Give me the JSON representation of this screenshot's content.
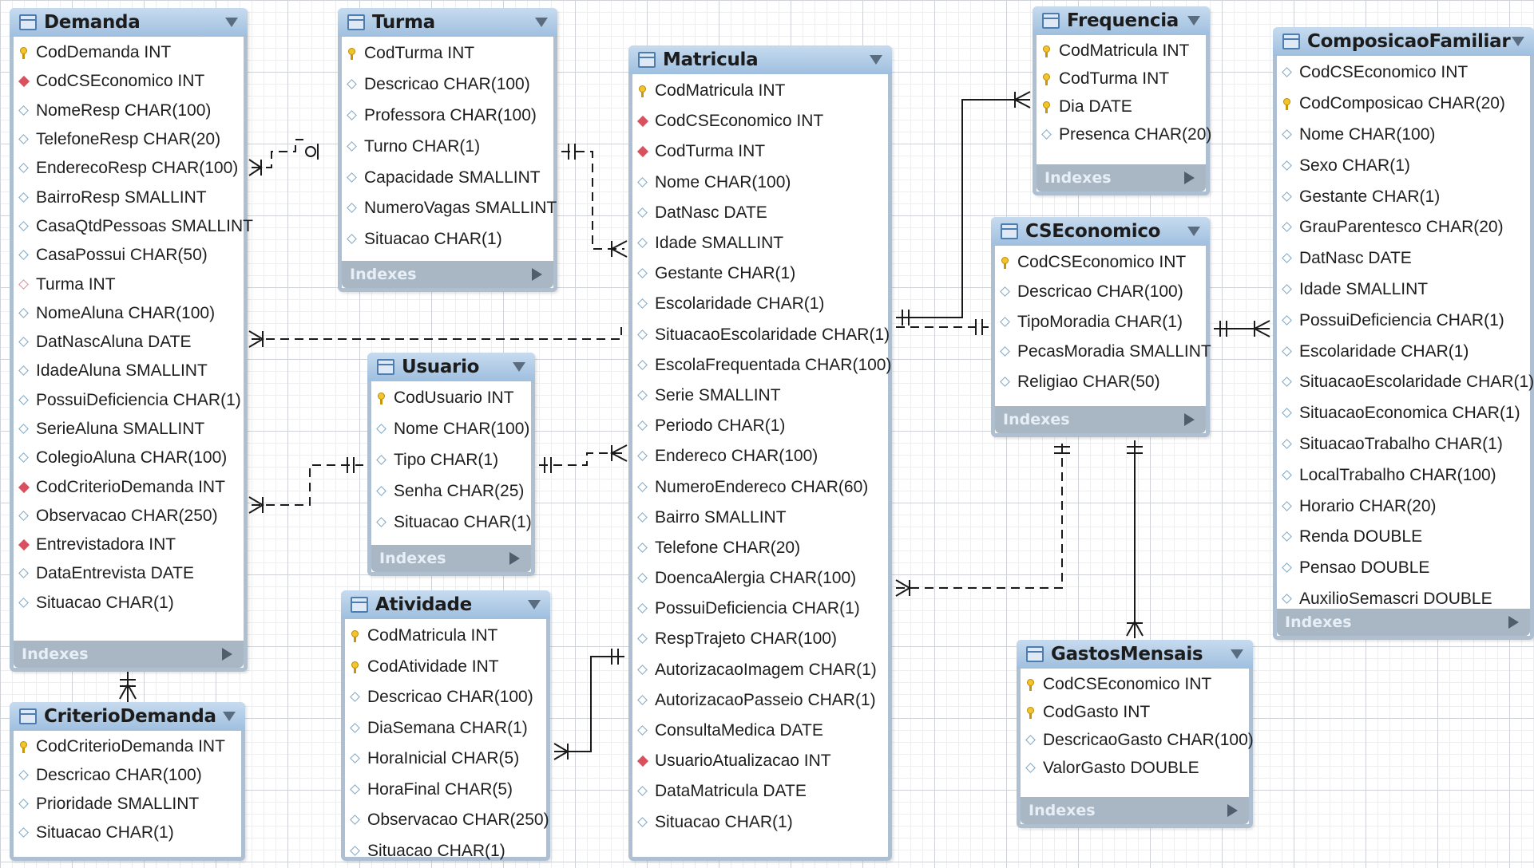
{
  "diagram": {
    "indexes_label": "Indexes",
    "tables": [
      {
        "id": "demanda",
        "name": "Demanda",
        "columns": [
          {
            "kind": "pk",
            "label": "CodDemanda INT"
          },
          {
            "kind": "fk",
            "label": "CodCSEconomico INT"
          },
          {
            "kind": "col",
            "label": "NomeResp CHAR(100)"
          },
          {
            "kind": "col",
            "label": "TelefoneResp CHAR(20)"
          },
          {
            "kind": "col",
            "label": "EnderecoResp CHAR(100)"
          },
          {
            "kind": "col",
            "label": "BairroResp SMALLINT"
          },
          {
            "kind": "col",
            "label": "CasaQtdPessoas SMALLINT"
          },
          {
            "kind": "col",
            "label": "CasaPossui CHAR(50)"
          },
          {
            "kind": "col-red",
            "label": "Turma INT"
          },
          {
            "kind": "col",
            "label": "NomeAluna CHAR(100)"
          },
          {
            "kind": "col",
            "label": "DatNascAluna DATE"
          },
          {
            "kind": "col",
            "label": "IdadeAluna SMALLINT"
          },
          {
            "kind": "col",
            "label": "PossuiDeficiencia CHAR(1)"
          },
          {
            "kind": "col",
            "label": "SerieAluna SMALLINT"
          },
          {
            "kind": "col",
            "label": "ColegioAluna CHAR(100)"
          },
          {
            "kind": "fk",
            "label": "CodCriterioDemanda INT"
          },
          {
            "kind": "col",
            "label": "Observacao CHAR(250)"
          },
          {
            "kind": "fk",
            "label": "Entrevistadora INT"
          },
          {
            "kind": "col",
            "label": "DataEntrevista DATE"
          },
          {
            "kind": "col",
            "label": "Situacao CHAR(1)"
          }
        ]
      },
      {
        "id": "turma",
        "name": "Turma",
        "columns": [
          {
            "kind": "pk",
            "label": "CodTurma INT"
          },
          {
            "kind": "col",
            "label": "Descricao CHAR(100)"
          },
          {
            "kind": "col",
            "label": "Professora CHAR(100)"
          },
          {
            "kind": "col",
            "label": "Turno CHAR(1)"
          },
          {
            "kind": "col",
            "label": "Capacidade SMALLINT"
          },
          {
            "kind": "col",
            "label": "NumeroVagas SMALLINT"
          },
          {
            "kind": "col",
            "label": "Situacao CHAR(1)"
          }
        ]
      },
      {
        "id": "matricula",
        "name": "Matricula",
        "columns": [
          {
            "kind": "pk",
            "label": "CodMatricula INT"
          },
          {
            "kind": "fk",
            "label": "CodCSEconomico INT"
          },
          {
            "kind": "fk",
            "label": "CodTurma INT"
          },
          {
            "kind": "col",
            "label": "Nome CHAR(100)"
          },
          {
            "kind": "col",
            "label": "DatNasc DATE"
          },
          {
            "kind": "col",
            "label": "Idade SMALLINT"
          },
          {
            "kind": "col",
            "label": "Gestante CHAR(1)"
          },
          {
            "kind": "col",
            "label": "Escolaridade CHAR(1)"
          },
          {
            "kind": "col",
            "label": "SituacaoEscolaridade CHAR(1)"
          },
          {
            "kind": "col",
            "label": "EscolaFrequentada CHAR(100)"
          },
          {
            "kind": "col",
            "label": "Serie SMALLINT"
          },
          {
            "kind": "col",
            "label": "Periodo CHAR(1)"
          },
          {
            "kind": "col",
            "label": "Endereco CHAR(100)"
          },
          {
            "kind": "col",
            "label": "NumeroEndereco CHAR(60)"
          },
          {
            "kind": "col",
            "label": "Bairro SMALLINT"
          },
          {
            "kind": "col",
            "label": "Telefone CHAR(20)"
          },
          {
            "kind": "col",
            "label": "DoencaAlergia CHAR(100)"
          },
          {
            "kind": "col",
            "label": "PossuiDeficiencia CHAR(1)"
          },
          {
            "kind": "col",
            "label": "RespTrajeto CHAR(100)"
          },
          {
            "kind": "col",
            "label": "AutorizacaoImagem CHAR(1)"
          },
          {
            "kind": "col",
            "label": "AutorizacaoPasseio CHAR(1)"
          },
          {
            "kind": "col",
            "label": "ConsultaMedica DATE"
          },
          {
            "kind": "fk",
            "label": "UsuarioAtualizacao INT"
          },
          {
            "kind": "col",
            "label": "DataMatricula DATE"
          },
          {
            "kind": "col",
            "label": "Situacao CHAR(1)"
          }
        ]
      },
      {
        "id": "frequencia",
        "name": "Frequencia",
        "columns": [
          {
            "kind": "pk",
            "label": "CodMatricula INT"
          },
          {
            "kind": "pk",
            "label": "CodTurma INT"
          },
          {
            "kind": "pk",
            "label": "Dia DATE"
          },
          {
            "kind": "col",
            "label": "Presenca CHAR(20)"
          }
        ]
      },
      {
        "id": "cseconomico",
        "name": "CSEconomico",
        "columns": [
          {
            "kind": "pk",
            "label": "CodCSEconomico INT"
          },
          {
            "kind": "col",
            "label": "Descricao CHAR(100)"
          },
          {
            "kind": "col",
            "label": "TipoMoradia CHAR(1)"
          },
          {
            "kind": "col",
            "label": "PecasMoradia SMALLINT"
          },
          {
            "kind": "col",
            "label": "Religiao CHAR(50)"
          }
        ]
      },
      {
        "id": "composicao",
        "name": "ComposicaoFamiliar",
        "columns": [
          {
            "kind": "col",
            "label": "CodCSEconomico INT"
          },
          {
            "kind": "pk",
            "label": "CodComposicao CHAR(20)"
          },
          {
            "kind": "col",
            "label": "Nome CHAR(100)"
          },
          {
            "kind": "col",
            "label": "Sexo CHAR(1)"
          },
          {
            "kind": "col",
            "label": "Gestante CHAR(1)"
          },
          {
            "kind": "col",
            "label": "GrauParentesco CHAR(20)"
          },
          {
            "kind": "col",
            "label": "DatNasc DATE"
          },
          {
            "kind": "col",
            "label": "Idade SMALLINT"
          },
          {
            "kind": "col",
            "label": "PossuiDeficiencia CHAR(1)"
          },
          {
            "kind": "col",
            "label": "Escolaridade CHAR(1)"
          },
          {
            "kind": "col",
            "label": "SituacaoEscolaridade CHAR(1)"
          },
          {
            "kind": "col",
            "label": "SituacaoEconomica CHAR(1)"
          },
          {
            "kind": "col",
            "label": "SituacaoTrabalho CHAR(1)"
          },
          {
            "kind": "col",
            "label": "LocalTrabalho CHAR(100)"
          },
          {
            "kind": "col",
            "label": "Horario CHAR(20)"
          },
          {
            "kind": "col",
            "label": "Renda DOUBLE"
          },
          {
            "kind": "col",
            "label": "Pensao DOUBLE"
          },
          {
            "kind": "col",
            "label": "AuxilioSemascri DOUBLE"
          }
        ]
      },
      {
        "id": "usuario",
        "name": "Usuario",
        "columns": [
          {
            "kind": "pk",
            "label": "CodUsuario INT"
          },
          {
            "kind": "col",
            "label": "Nome CHAR(100)"
          },
          {
            "kind": "col",
            "label": "Tipo CHAR(1)"
          },
          {
            "kind": "col",
            "label": "Senha CHAR(25)"
          },
          {
            "kind": "col",
            "label": "Situacao CHAR(1)"
          }
        ]
      },
      {
        "id": "atividade",
        "name": "Atividade",
        "columns": [
          {
            "kind": "pk",
            "label": "CodMatricula INT"
          },
          {
            "kind": "pk",
            "label": "CodAtividade INT"
          },
          {
            "kind": "col",
            "label": "Descricao CHAR(100)"
          },
          {
            "kind": "col",
            "label": "DiaSemana CHAR(1)"
          },
          {
            "kind": "col",
            "label": "HoraInicial CHAR(5)"
          },
          {
            "kind": "col",
            "label": "HoraFinal CHAR(5)"
          },
          {
            "kind": "col",
            "label": "Observacao CHAR(250)"
          },
          {
            "kind": "col",
            "label": "Situacao CHAR(1)"
          }
        ]
      },
      {
        "id": "criterio",
        "name": "CriterioDemanda",
        "columns": [
          {
            "kind": "pk",
            "label": "CodCriterioDemanda INT"
          },
          {
            "kind": "col",
            "label": "Descricao CHAR(100)"
          },
          {
            "kind": "col",
            "label": "Prioridade SMALLINT"
          },
          {
            "kind": "col",
            "label": "Situacao CHAR(1)"
          }
        ]
      },
      {
        "id": "gastos",
        "name": "GastosMensais",
        "columns": [
          {
            "kind": "pk",
            "label": "CodCSEconomico INT"
          },
          {
            "kind": "pk",
            "label": "CodGasto INT"
          },
          {
            "kind": "col",
            "label": "DescricaoGasto CHAR(100)"
          },
          {
            "kind": "col",
            "label": "ValorGasto DOUBLE"
          }
        ]
      }
    ]
  }
}
